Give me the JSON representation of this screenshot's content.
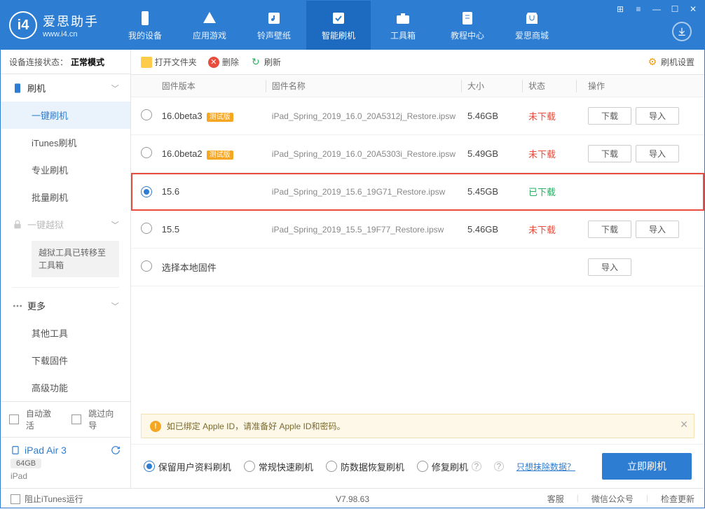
{
  "app": {
    "title": "爱思助手",
    "subtitle": "www.i4.cn",
    "logo_letter": "i4"
  },
  "nav": [
    {
      "label": "我的设备",
      "icon": "phone"
    },
    {
      "label": "应用游戏",
      "icon": "apps"
    },
    {
      "label": "铃声壁纸",
      "icon": "media"
    },
    {
      "label": "智能刷机",
      "icon": "flash",
      "active": true
    },
    {
      "label": "工具箱",
      "icon": "toolbox"
    },
    {
      "label": "教程中心",
      "icon": "docs"
    },
    {
      "label": "爱思商城",
      "icon": "store"
    }
  ],
  "conn_status": {
    "label": "设备连接状态：",
    "value": "正常模式"
  },
  "sidebar": {
    "group_flash": {
      "label": "刷机"
    },
    "items_flash": [
      {
        "label": "一键刷机",
        "active": true
      },
      {
        "label": "iTunes刷机"
      },
      {
        "label": "专业刷机"
      },
      {
        "label": "批量刷机"
      }
    ],
    "group_jailbreak": {
      "label": "一键越狱",
      "disabled": true
    },
    "jailbreak_notice": "越狱工具已转移至工具箱",
    "group_more": {
      "label": "更多"
    },
    "items_more": [
      {
        "label": "其他工具"
      },
      {
        "label": "下载固件"
      },
      {
        "label": "高级功能"
      }
    ],
    "auto_activate": "自动激活",
    "skip_guide": "跳过向导"
  },
  "device": {
    "name": "iPad Air 3",
    "storage": "64GB",
    "type": "iPad"
  },
  "toolbar": {
    "open_folder": "打开文件夹",
    "delete": "删除",
    "refresh": "刷新",
    "settings": "刷机设置"
  },
  "table": {
    "headers": {
      "version": "固件版本",
      "name": "固件名称",
      "size": "大小",
      "status": "状态",
      "ops": "操作"
    },
    "btn_download": "下载",
    "btn_import": "导入",
    "local_firmware": "选择本地固件",
    "rows": [
      {
        "version": "16.0beta3",
        "beta": true,
        "filename": "iPad_Spring_2019_16.0_20A5312j_Restore.ipsw",
        "size": "5.46GB",
        "status": "未下载",
        "status_class": "not",
        "selected": false
      },
      {
        "version": "16.0beta2",
        "beta": true,
        "filename": "iPad_Spring_2019_16.0_20A5303i_Restore.ipsw",
        "size": "5.49GB",
        "status": "未下载",
        "status_class": "not",
        "selected": false
      },
      {
        "version": "15.6",
        "beta": false,
        "filename": "iPad_Spring_2019_15.6_19G71_Restore.ipsw",
        "size": "5.45GB",
        "status": "已下载",
        "status_class": "done",
        "selected": true,
        "highlighted": true,
        "no_ops": true
      },
      {
        "version": "15.5",
        "beta": false,
        "filename": "iPad_Spring_2019_15.5_19F77_Restore.ipsw",
        "size": "5.46GB",
        "status": "未下载",
        "status_class": "not",
        "selected": false
      }
    ]
  },
  "notice": "如已绑定 Apple ID，请准备好 Apple ID和密码。",
  "options": {
    "opt1": "保留用户资料刷机",
    "opt2": "常规快速刷机",
    "opt3": "防数据恢复刷机",
    "opt4": "修复刷机",
    "erase_link": "只想抹除数据？",
    "flash_btn": "立即刷机"
  },
  "beta_tag": "测试版",
  "statusbar": {
    "block_itunes": "阻止iTunes运行",
    "version": "V7.98.63",
    "support": "客服",
    "wechat": "微信公众号",
    "update": "检查更新"
  }
}
